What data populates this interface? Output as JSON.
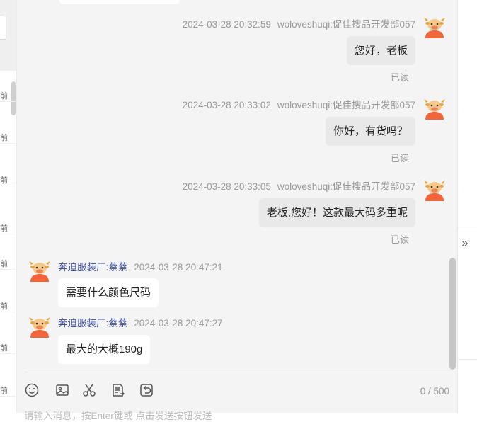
{
  "sidebar": {
    "item_suffix": [
      "前",
      "前",
      "前",
      "前",
      "前",
      "前",
      "前",
      "前"
    ]
  },
  "messages": [
    {
      "direction": "out",
      "time": "2024-03-28 20:32:59",
      "sender": "woloveshuqi:促佳搜品开发部057",
      "text": "您好，老板",
      "status": "已读"
    },
    {
      "direction": "out",
      "time": "2024-03-28 20:33:02",
      "sender": "woloveshuqi:促佳搜品开发部057",
      "text": "你好，有货吗？",
      "status": "已读"
    },
    {
      "direction": "out",
      "time": "2024-03-28 20:33:05",
      "sender": "woloveshuqi:促佳搜品开发部057",
      "text": "老板,您好！这款最大码多重呢",
      "status": "已读"
    },
    {
      "direction": "in",
      "time": "2024-03-28 20:47:21",
      "sender": "奔迫服装厂:蔡蔡",
      "text": "需要什么颜色尺码"
    },
    {
      "direction": "in",
      "time": "2024-03-28 20:47:27",
      "sender": "奔迫服装厂:蔡蔡",
      "text": "最大的大概190g"
    }
  ],
  "toolbar": {
    "icons": [
      "emoji-icon",
      "image-icon",
      "scissors-icon",
      "order-icon",
      "recall-icon"
    ],
    "counter": "0 / 500"
  },
  "input": {
    "placeholder": "请输入消息，按Enter键或 点击发送按钮发送"
  },
  "colors": {
    "accent": "#ff6a00",
    "sender_name": "#3b4d9a",
    "chat_bg": "#f4f4f4",
    "outgoing_bubble": "#e9e9e9"
  }
}
